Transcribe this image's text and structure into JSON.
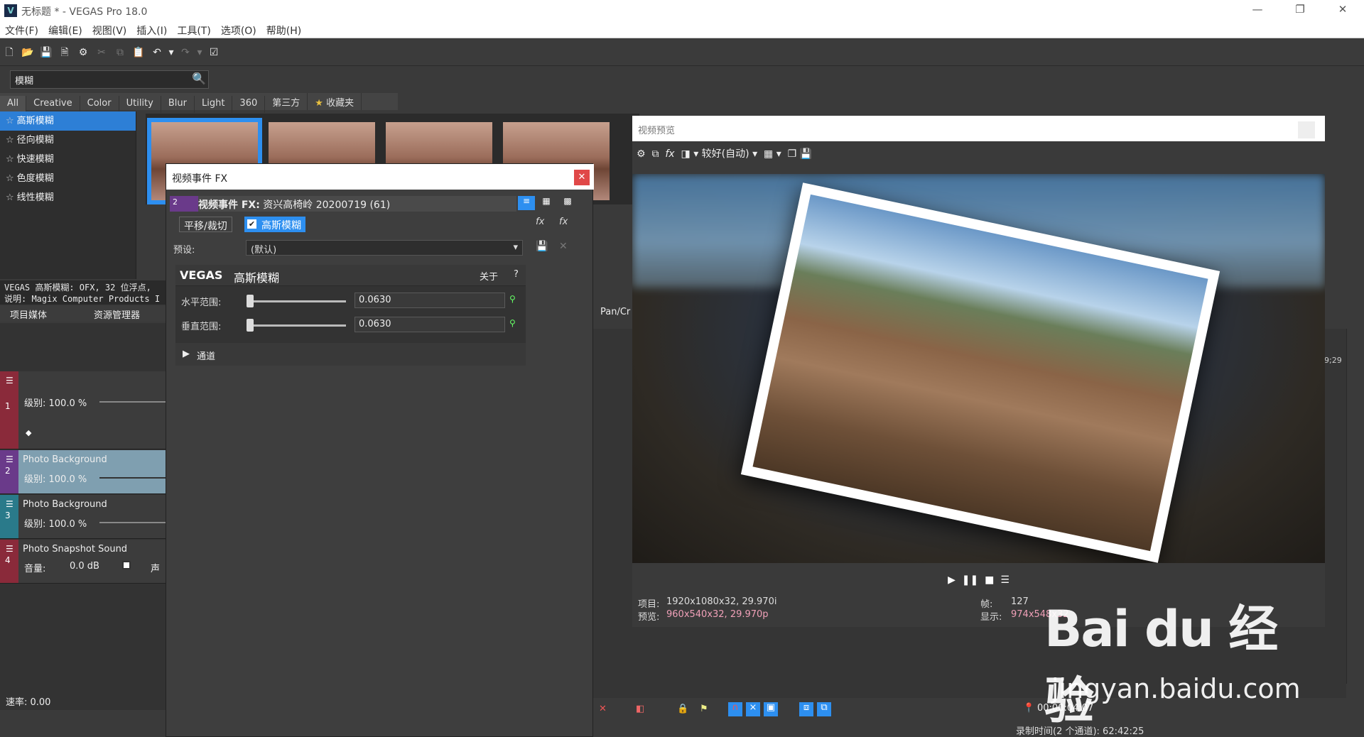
{
  "window": {
    "title": "无标题 * - VEGAS Pro 18.0",
    "logo": "V",
    "controls": [
      "—",
      "❐",
      "✕"
    ]
  },
  "menu": [
    "文件(F)",
    "编辑(E)",
    "视图(V)",
    "插入(I)",
    "工具(T)",
    "选项(O)",
    "帮助(H)"
  ],
  "fx_browser": {
    "search_value": "模糊",
    "categories": [
      "All",
      "Creative",
      "Color",
      "Utility",
      "Blur",
      "Light",
      "360",
      "第三方",
      "收藏夹"
    ],
    "items": [
      "高斯模糊",
      "径向模糊",
      "快速模糊",
      "色度模糊",
      "线性模糊"
    ],
    "selected_index": 0,
    "description_lines": [
      "VEGAS 高斯模糊: OFX, 32 位浮点,",
      "说明: Magix Computer Products I"
    ]
  },
  "panel_tabs": [
    "项目媒体",
    "资源管理器"
  ],
  "tracks": [
    {
      "num": "1",
      "name": "",
      "level": "级别: 100.0 %",
      "color": "#8a2a3a"
    },
    {
      "num": "2",
      "name": "Photo Background",
      "level": "级别: 100.0 %",
      "color": "#6a3a8a"
    },
    {
      "num": "3",
      "name": "Photo Background",
      "level": "级别: 100.0 %",
      "color": "#2a7a8a"
    },
    {
      "num": "4",
      "name": "Photo Snapshot Sound",
      "level": "音量:",
      "extra": "0.0 dB",
      "extra2": "声",
      "color": "#8a2a3a"
    }
  ],
  "rate": "速率: 0.00",
  "fx_dialog": {
    "title": "视频事件 FX",
    "chain_badge": "2",
    "chain_label": "视频事件 FX:",
    "chain_value": "资兴高椅岭 20200719 (61)",
    "plugin_tabs": [
      "平移/裁切",
      "高斯模糊"
    ],
    "preset_label": "预设:",
    "preset_value": "(默认)",
    "plugin_brand": "VEGAS",
    "plugin_name": "高斯模糊",
    "about": "关于",
    "help": "?",
    "params": [
      {
        "label": "水平范围:",
        "value": "0.0630"
      },
      {
        "label": "垂直范围:",
        "value": "0.0630"
      }
    ],
    "channel": "通道"
  },
  "preview": {
    "title": "视频预览",
    "quality": "较好(自动)",
    "project_label": "项目:",
    "project_value": "1920x1080x32, 29.970i",
    "preview_label": "预览:",
    "preview_value": "960x540x32, 29.970p",
    "frame_label": "帧:",
    "frame_value": "127",
    "display_label": "显示:",
    "display_value": "974x548x32"
  },
  "timeline": {
    "pan_label": "Pan/Cr",
    "time_marker": "9;29",
    "timecode": "00:00:04;07"
  },
  "status": {
    "record_time": "录制时间(2 个通道): 62:42:25"
  },
  "watermark": {
    "main": "Bai du 经验",
    "sub": "jingyan.baidu.com"
  },
  "colors": {
    "accent": "#2d8ff0",
    "highlight_value": "#f0a0b8",
    "close": "#e04848"
  }
}
